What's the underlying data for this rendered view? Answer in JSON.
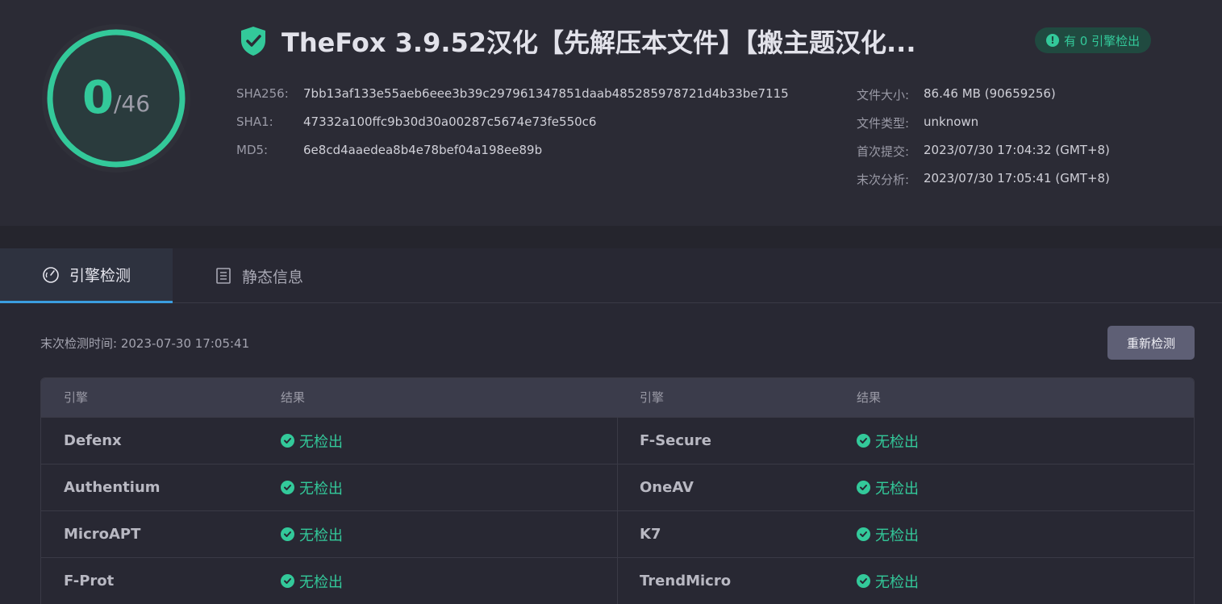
{
  "score": {
    "detected": "0",
    "total": "/46"
  },
  "file": {
    "title": "TheFox 3.9.52汉化【先解压本文件】【搬主题汉化...",
    "badge": "有 0 引擎检出",
    "hashes": [
      {
        "key": "SHA256:",
        "value": "7bb13af133e55aeb6eee3b39c297961347851daab485285978721d4b33be7115"
      },
      {
        "key": "SHA1:",
        "value": "47332a100ffc9b30d30a00287c5674e73fe550c6"
      },
      {
        "key": "MD5:",
        "value": "6e8cd4aaedea8b4e78bef04a198ee89b"
      }
    ],
    "meta": [
      {
        "key": "文件大小:",
        "value": "86.46 MB (90659256)"
      },
      {
        "key": "文件类型:",
        "value": "unknown"
      },
      {
        "key": "首次提交:",
        "value": "2023/07/30 17:04:32 (GMT+8)"
      },
      {
        "key": "末次分析:",
        "value": "2023/07/30 17:05:41 (GMT+8)"
      }
    ]
  },
  "tabs": [
    {
      "label": "引擎检测",
      "icon": "gauge-icon",
      "active": true
    },
    {
      "label": "静态信息",
      "icon": "document-list-icon",
      "active": false
    }
  ],
  "detection": {
    "last_check": "末次检测时间: 2023-07-30 17:05:41",
    "rescan_label": "重新检测",
    "headers": {
      "engine": "引擎",
      "result": "结果"
    },
    "rows": [
      {
        "left": {
          "engine": "Defenx",
          "result": "无检出"
        },
        "right": {
          "engine": "F-Secure",
          "result": "无检出"
        }
      },
      {
        "left": {
          "engine": "Authentium",
          "result": "无检出"
        },
        "right": {
          "engine": "OneAV",
          "result": "无检出"
        }
      },
      {
        "left": {
          "engine": "MicroAPT",
          "result": "无检出"
        },
        "right": {
          "engine": "K7",
          "result": "无检出"
        }
      },
      {
        "left": {
          "engine": "F-Prot",
          "result": "无检出"
        },
        "right": {
          "engine": "TrendMicro",
          "result": "无检出"
        }
      }
    ]
  },
  "colors": {
    "accent": "#33c99a",
    "background": "#282833",
    "header": "#2b2b35",
    "tab_indicator": "#3b9ee0"
  }
}
